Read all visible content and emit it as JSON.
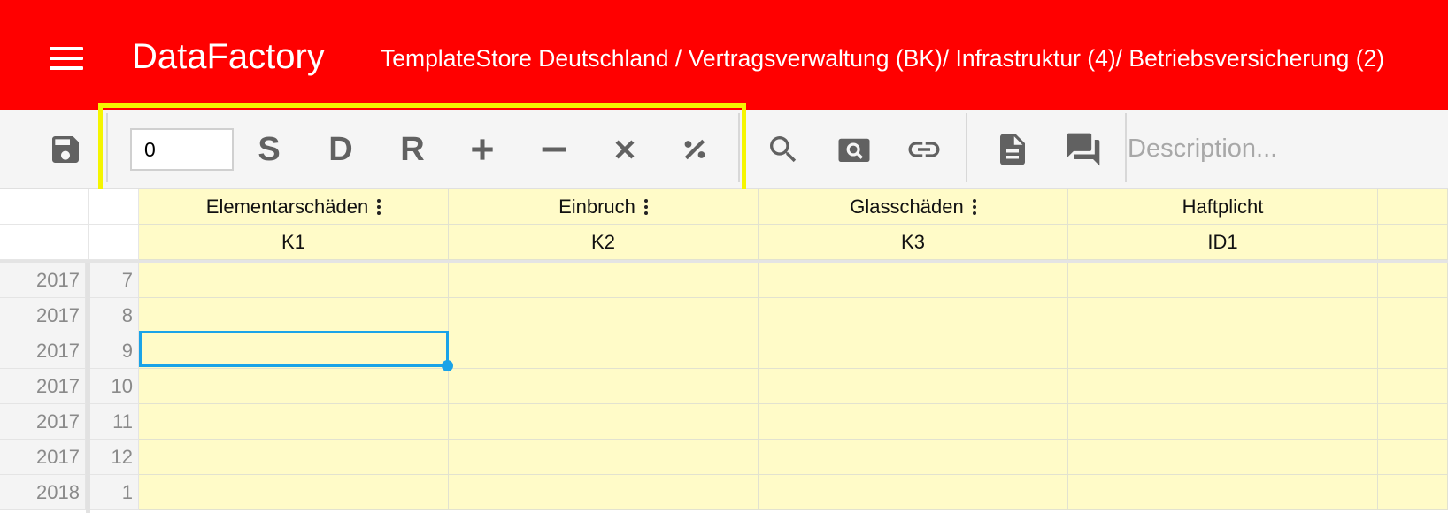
{
  "header": {
    "brand": "DataFactory",
    "breadcrumb": "TemplateStore Deutschland / Vertragsverwaltung (BK)/ Infrastruktur (4)/ Betriebsversicherung (2)",
    "background_color": "#ff0000"
  },
  "toolbar": {
    "number_input_value": "0",
    "letters": {
      "s": "S",
      "d": "D",
      "r": "R"
    },
    "description_placeholder": "Description...",
    "highlight_color": "#f5f500",
    "icons": [
      "save-icon",
      "plus-icon",
      "minus-icon",
      "multiply-icon",
      "percent-icon",
      "search-icon",
      "image-search-icon",
      "link-icon",
      "document-icon",
      "comment-icon"
    ]
  },
  "grid": {
    "columns": [
      {
        "name": "Elementarschäden",
        "code": "K1",
        "has_menu": true
      },
      {
        "name": "Einbruch",
        "code": "K2",
        "has_menu": true
      },
      {
        "name": "Glasschäden",
        "code": "K3",
        "has_menu": true
      },
      {
        "name": "Haftplicht",
        "code": "ID1",
        "has_menu": false
      }
    ],
    "rows": [
      {
        "year": "2017",
        "month": "7"
      },
      {
        "year": "2017",
        "month": "8"
      },
      {
        "year": "2017",
        "month": "9"
      },
      {
        "year": "2017",
        "month": "10"
      },
      {
        "year": "2017",
        "month": "11"
      },
      {
        "year": "2017",
        "month": "12"
      },
      {
        "year": "2018",
        "month": "1"
      }
    ],
    "selected_cell": {
      "row": "9",
      "column": "K1"
    },
    "cell_color": "#fffbc8",
    "selection_color": "#1aa3e8"
  }
}
